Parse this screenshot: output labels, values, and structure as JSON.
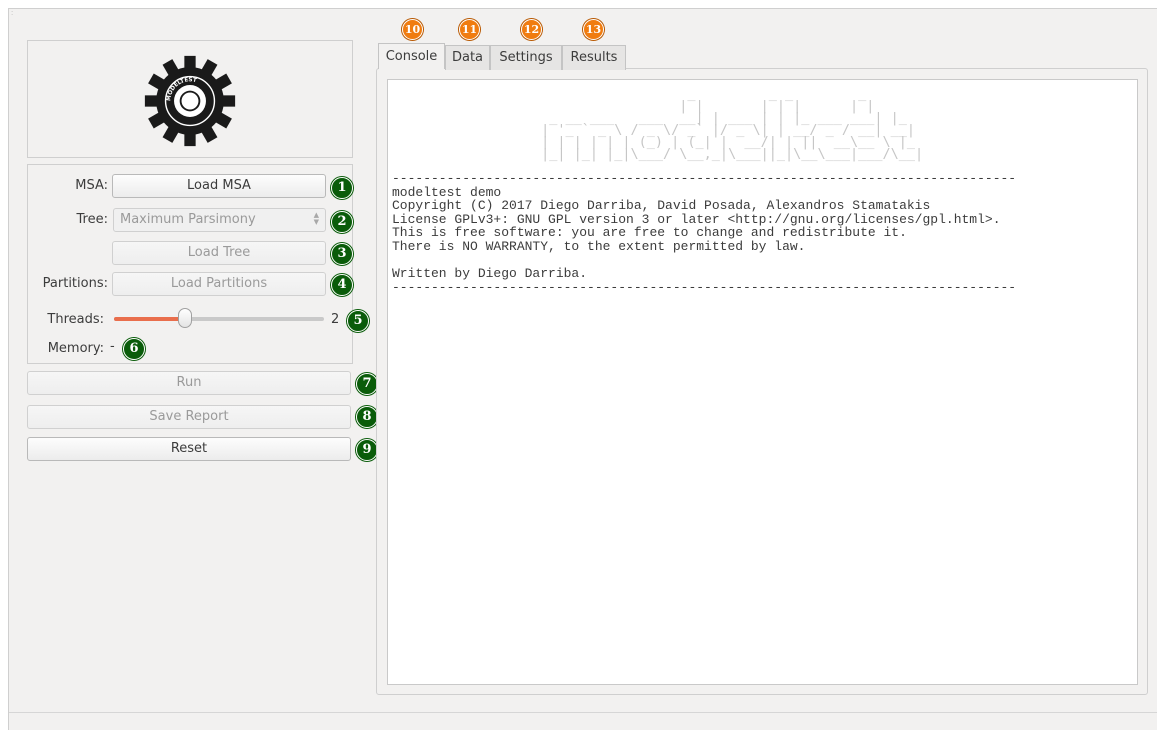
{
  "sidebar": {
    "msa_label": "MSA:",
    "load_msa_button": "Load MSA",
    "tree_label": "Tree:",
    "tree_select_value": "Maximum Parsimony",
    "load_tree_button": "Load Tree",
    "partitions_label": "Partitions:",
    "load_partitions_button": "Load Partitions",
    "threads_label": "Threads:",
    "threads_value": "2",
    "threads_slider_fraction": 0.34,
    "memory_label": "Memory:",
    "memory_value": "-"
  },
  "actions": {
    "run_button": "Run",
    "save_report_button": "Save Report",
    "reset_button": "Reset"
  },
  "tabs": [
    {
      "label": "Console",
      "active": true
    },
    {
      "label": "Data",
      "active": false
    },
    {
      "label": "Settings",
      "active": false
    },
    {
      "label": "Results",
      "active": false
    }
  ],
  "badges": {
    "b1": "1",
    "b2": "2",
    "b3": "3",
    "b4": "4",
    "b5": "5",
    "b6": "6",
    "b7": "7",
    "b8": "8",
    "b9": "9",
    "b10": "10",
    "b11": "11",
    "b12": "12",
    "b13": "13"
  },
  "console": {
    "ascii_banner": "                   _         _ _        _   \n                  | |       | | |      | |  \n  _ __ ___   ___  __| | ___ | | |_ ___ ___| |_ \n | '_ ` _ \\ / _ \\/ _` |/ _ \\| | __/ _ / __| __|\n | | | | | | (_) | (_| |  __/| | ||  __\\__ \\ |_ \n |_| |_| |_|\\___/ \\__,_|\\___||_|\\__\\___|___/\\__|",
    "text": "--------------------------------------------------------------------------------\nmodeltest demo\nCopyright (C) 2017 Diego Darriba, David Posada, Alexandros Stamatakis\nLicense GPLv3+: GNU GPL version 3 or later <http://gnu.org/licenses/gpl.html>.\nThis is free software: you are free to change and redistribute it.\nThere is NO WARRANTY, to the extent permitted by law.\n\nWritten by Diego Darriba.\n--------------------------------------------------------------------------------"
  },
  "logo": {
    "ring_text": "MODELTEST",
    "color": "#1a1a1a"
  },
  "colors": {
    "accent_slider": "#e96e4c",
    "badge_green": "#0a5c0a",
    "badge_orange": "#f07c10"
  }
}
